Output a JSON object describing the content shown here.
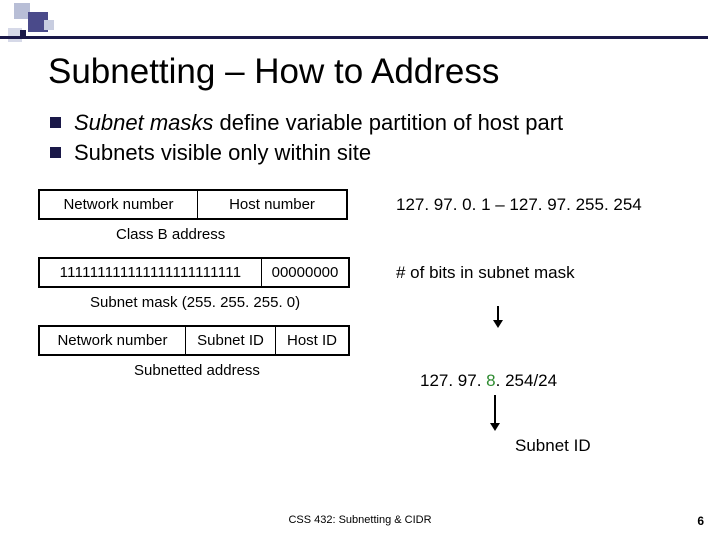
{
  "title": "Subnetting – How to Address",
  "bullets": [
    {
      "italic": "Subnet masks",
      "rest": " define variable partition of host part"
    },
    {
      "italic": "",
      "rest": "Subnets visible only within site"
    }
  ],
  "row1": {
    "net": "Network number",
    "host": "Host number",
    "range": "127. 97. 0. 1 – 127. 97. 255. 254"
  },
  "caption1": "Class B address",
  "row2": {
    "ones": "111111111111111111111111",
    "zeros": "00000000",
    "desc": "# of bits in subnet mask"
  },
  "caption2": "Subnet mask (255. 255. 255. 0)",
  "row3": {
    "net": "Network number",
    "sub": "Subnet ID",
    "hid": "Host ID"
  },
  "cidr": {
    "pre": "127. 97. ",
    "green": "8",
    "post": ". 254/24"
  },
  "subnet_id_label": "Subnet ID",
  "caption3": "Subnetted address",
  "footer": "CSS 432: Subnetting & CIDR",
  "pagenum": "6"
}
